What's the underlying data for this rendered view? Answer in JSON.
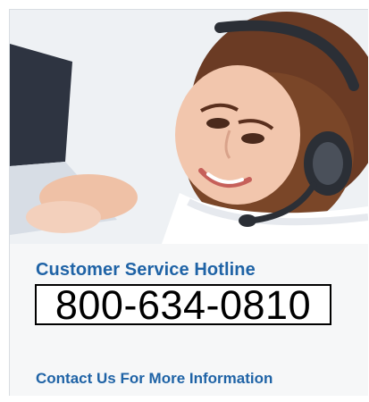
{
  "hero": {
    "image_subject": "customer-service-agent-with-headset",
    "colors": {
      "background": "#eef1f4",
      "skin": "#f2c6ad",
      "hair": "#6b3b24",
      "headset": "#2b2f36",
      "laptop": "#2e3441"
    }
  },
  "hotline": {
    "title": "Customer Service Hotline",
    "phone": "800-634-0810"
  },
  "contact": {
    "link_text": "Contact Us For More Information"
  },
  "colors": {
    "accent_blue": "#1f63a6",
    "panel": "#f6f7f8"
  }
}
